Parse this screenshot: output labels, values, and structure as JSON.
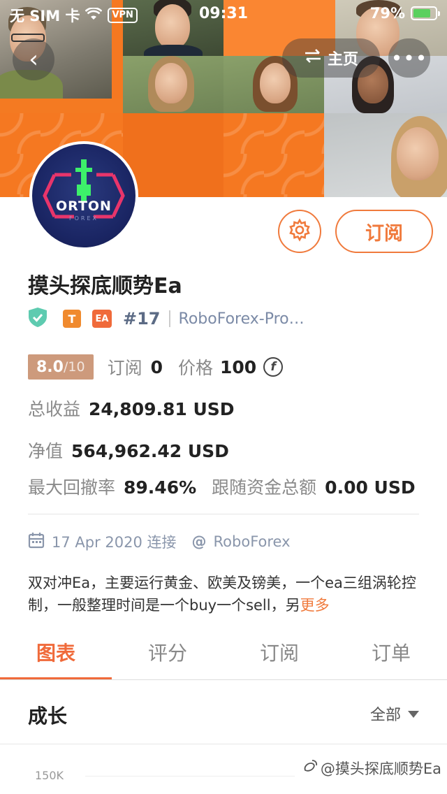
{
  "status_bar": {
    "carrier": "无 SIM 卡",
    "vpn": "VPN",
    "time": "09:31",
    "battery": "79%",
    "battery_level": 0.79
  },
  "nav": {
    "home_label": "主页"
  },
  "avatar": {
    "brand_line1": "ORTON",
    "brand_line2": "FOREX"
  },
  "actions": {
    "subscribe_label": "订阅"
  },
  "strategy": {
    "title": "摸头探底顺势Ea",
    "badge_t": "T",
    "badge_ea": "EA",
    "rank": "#17",
    "broker": "RoboForex-Pro…"
  },
  "stats": {
    "score": "8.0",
    "score_max": "/10",
    "subscribe_label": "订阅",
    "subscribe_count": "0",
    "price_label": "价格",
    "price_value": "100",
    "price_symbol": "f",
    "total_profit_label": "总收益",
    "total_profit_value": "24,809.81 USD",
    "equity_label": "净值",
    "equity_value": "564,962.42 USD",
    "max_drawdown_label": "最大回撤率",
    "max_drawdown_value": "89.46%",
    "follow_funds_label": "跟随资金总额",
    "follow_funds_value": "0.00 USD"
  },
  "meta": {
    "date": "17 Apr 2020 连接",
    "at": "@",
    "broker": "RoboForex"
  },
  "description": {
    "text": "双对冲Ea，主要运行黄金、欧美及镑美，一个ea三组涡轮控制，一般整理时间是一个buy一个sell，另",
    "more": "更多"
  },
  "tabs": [
    {
      "label": "图表",
      "active": true
    },
    {
      "label": "评分",
      "active": false
    },
    {
      "label": "订阅",
      "active": false
    },
    {
      "label": "订单",
      "active": false
    }
  ],
  "growth": {
    "title": "成长",
    "filter": "全部",
    "axis_top": "150K"
  },
  "watermark": {
    "text": "@摸头探底顺势Ea"
  },
  "colors": {
    "accent": "#f06a3a",
    "banner_orange": "#f57821",
    "score_bg": "#cd9a7c"
  }
}
